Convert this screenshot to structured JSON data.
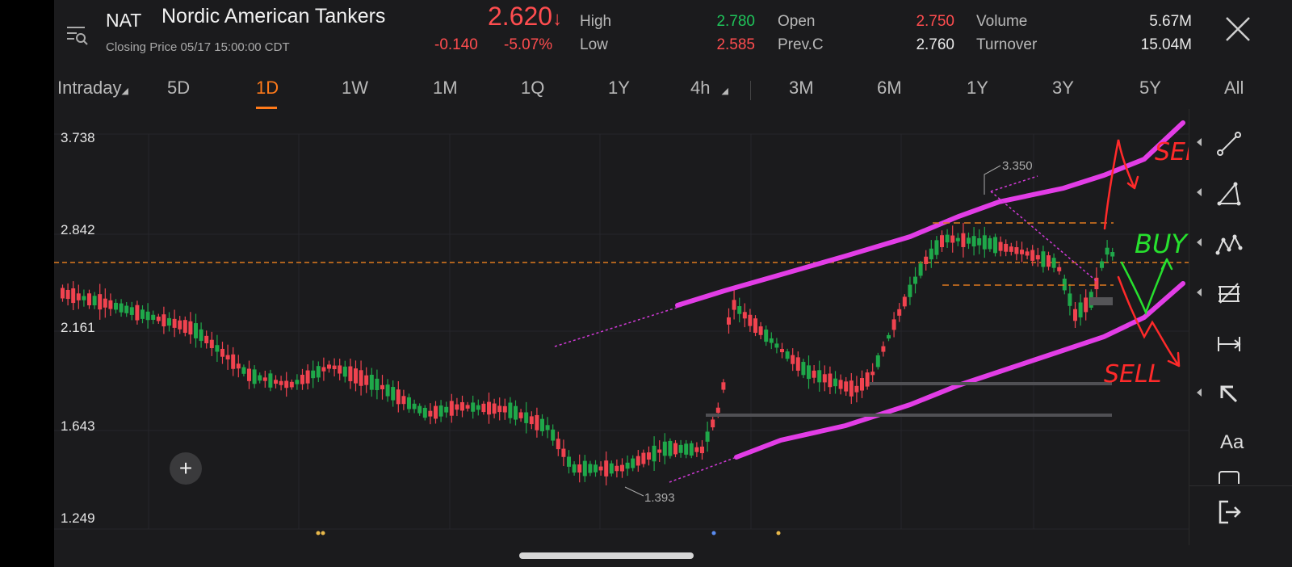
{
  "header": {
    "symbol": "NAT",
    "name": "Nordic American Tankers",
    "closing_label": "Closing Price  05/17 15:00:00 CDT",
    "price": "2.620",
    "price_arrow": "↓",
    "change": "-0.140",
    "change_pct": "-5.07%",
    "stats": {
      "high_label": "High",
      "high": "2.780",
      "low_label": "Low",
      "low": "2.585",
      "open_label": "Open",
      "open": "2.750",
      "prevc_label": "Prev.C",
      "prevc": "2.760",
      "volume_label": "Volume",
      "volume": "5.67M",
      "turnover_label": "Turnover",
      "turnover": "15.04M"
    }
  },
  "tabs": [
    "Intraday",
    "5D",
    "1D",
    "1W",
    "1M",
    "1Q",
    "1Y",
    "4h",
    "3M",
    "6M",
    "1Y",
    "3Y",
    "5Y",
    "All"
  ],
  "active_tab": "1D",
  "chart_data": {
    "type": "candlestick",
    "y_ticks": [
      "3.738",
      "2.842",
      "2.161",
      "1.643",
      "1.249"
    ],
    "ylim": [
      1.249,
      3.738
    ],
    "annotations": {
      "high_label": "3.350",
      "low_label": "1.393",
      "sell_top": "SELL",
      "buy": "BUY",
      "sell_bottom": "SELL"
    },
    "colors": {
      "up": "#1fa84a",
      "down": "#f0434f",
      "channel": "#e23de6",
      "sell": "#ff2a2a",
      "buy": "#27e02e",
      "dash": "#e07a1f"
    }
  },
  "toolbar": {
    "tools": [
      "line-tool-icon",
      "triangle-tool-icon",
      "pattern-tool-icon",
      "fib-tool-icon",
      "measure-tool-icon",
      "arrow-tool-icon",
      "text-tool-icon",
      "rect-tool-icon",
      "exit-tool-icon"
    ],
    "text_tool_label": "Aa"
  },
  "add_button_label": "+"
}
